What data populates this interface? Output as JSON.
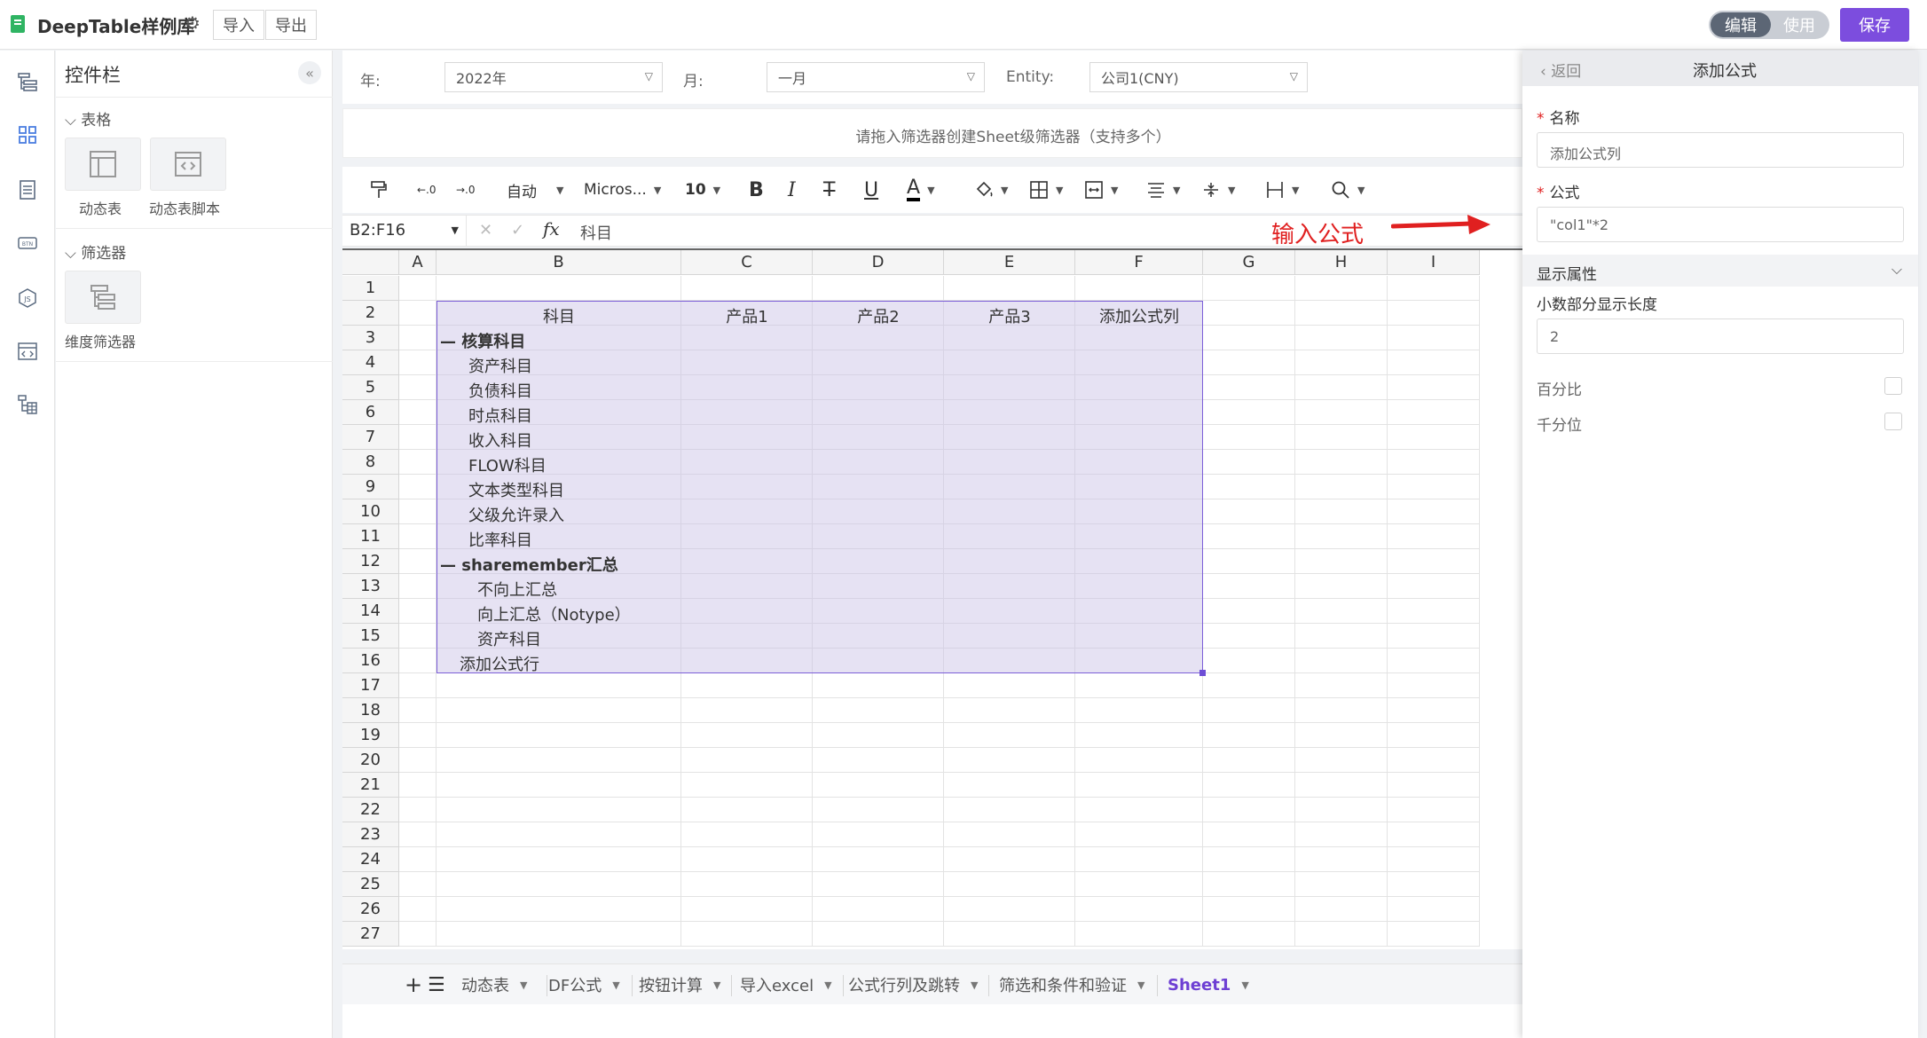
{
  "app": {
    "title": "DeepTable样例库",
    "import_label": "导入",
    "export_label": "导出",
    "mode_edit": "编辑",
    "mode_use": "使用",
    "save_label": "保存"
  },
  "panel": {
    "title": "控件栏",
    "section_tables": "表格",
    "widget_dynamic_table": "动态表",
    "widget_dynamic_script": "动态表脚本",
    "section_filters": "筛选器",
    "widget_dim_filter": "维度筛选器"
  },
  "filters": {
    "year_label": "年:",
    "year_value": "2022年",
    "month_label": "月:",
    "month_value": "一月",
    "entity_label": "Entity:",
    "entity_value": "公司1(CNY)"
  },
  "hint": "请拖入筛选器创建Sheet级筛选器（支持多个）",
  "toolbar": {
    "format_auto": "自动",
    "font_name": "Micros...",
    "font_size": "10"
  },
  "formula_bar": {
    "cell_ref": "B2:F16",
    "fx": "fx",
    "content": "科目"
  },
  "annotation": "输入公式",
  "grid": {
    "columns": [
      "A",
      "B",
      "C",
      "D",
      "E",
      "F",
      "G",
      "H",
      "I"
    ],
    "rows": [
      "1",
      "2",
      "3",
      "4",
      "5",
      "6",
      "7",
      "8",
      "9",
      "10",
      "11",
      "12",
      "13",
      "14",
      "15",
      "16",
      "17",
      "18",
      "19",
      "20",
      "21",
      "22",
      "23",
      "24",
      "25",
      "26",
      "27"
    ],
    "header_row": [
      "科目",
      "产品1",
      "产品2",
      "产品3",
      "添加公式列"
    ],
    "items": [
      "— 核算科目",
      "资产科目",
      "负债科目",
      "时点科目",
      "收入科目",
      "FLOW科目",
      "文本类型科目",
      "父级允许录入",
      "比率科目",
      "—  sharemember汇总",
      "不向上汇总",
      "向上汇总（Notype）",
      "资产科目",
      "添加公式行"
    ]
  },
  "sheet_tabs": [
    "动态表",
    "DF公式",
    "按钮计算",
    "导入excel",
    "公式行列及跳转",
    "筛选和条件和验证",
    "Sheet1"
  ],
  "drawer": {
    "back": "返回",
    "title": "添加公式",
    "name_label": "名称",
    "name_value": "添加公式列",
    "formula_label": "公式",
    "formula_value": "\"col1\"*2",
    "display_section": "显示属性",
    "decimal_label": "小数部分显示长度",
    "decimal_value": "2",
    "percent_label": "百分比",
    "thousands_label": "千分位"
  }
}
